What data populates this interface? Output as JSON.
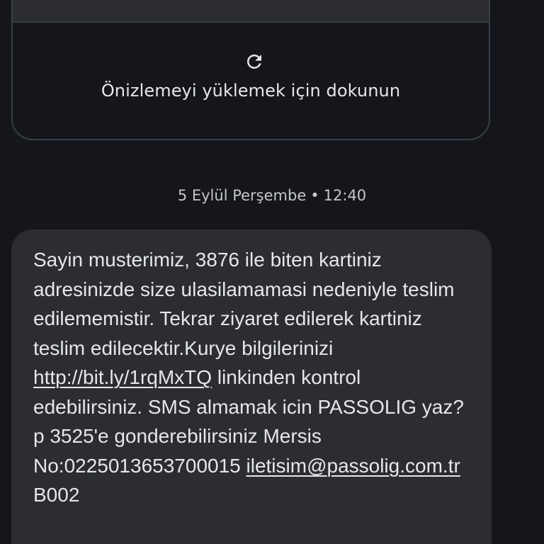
{
  "preview_card": {
    "refresh_icon": "refresh-icon",
    "tap_to_load_label": "Önizlemeyi yüklemek için dokunun"
  },
  "timestamp": {
    "date": "5 Eylül Perşembe",
    "separator": "•",
    "time": "12:40"
  },
  "message": {
    "part1": "Sayin musterimiz, 3876 ile biten kartiniz adresinizde size ulasilamamasi nedeniyle teslim edilememistir. Tekrar ziyaret edilerek kartiniz teslim edilecektir.Kurye bilgilerinizi ",
    "link": "http://bit.ly/1rqMxTQ",
    "part2": " linkinden kontrol edebilirsiniz. SMS almamak icin PASSOLIG yaz?p 3525'e gonderebilirsiniz Mersis No:0225013653700015 ",
    "email": "iletisim@passolig.com.tr",
    "part3": " B002"
  },
  "colors": {
    "background": "#14161c",
    "bubble": "#2b2d33",
    "text": "#e6e7ea",
    "muted_text": "#c4c6cc",
    "border": "#3a3d44"
  }
}
